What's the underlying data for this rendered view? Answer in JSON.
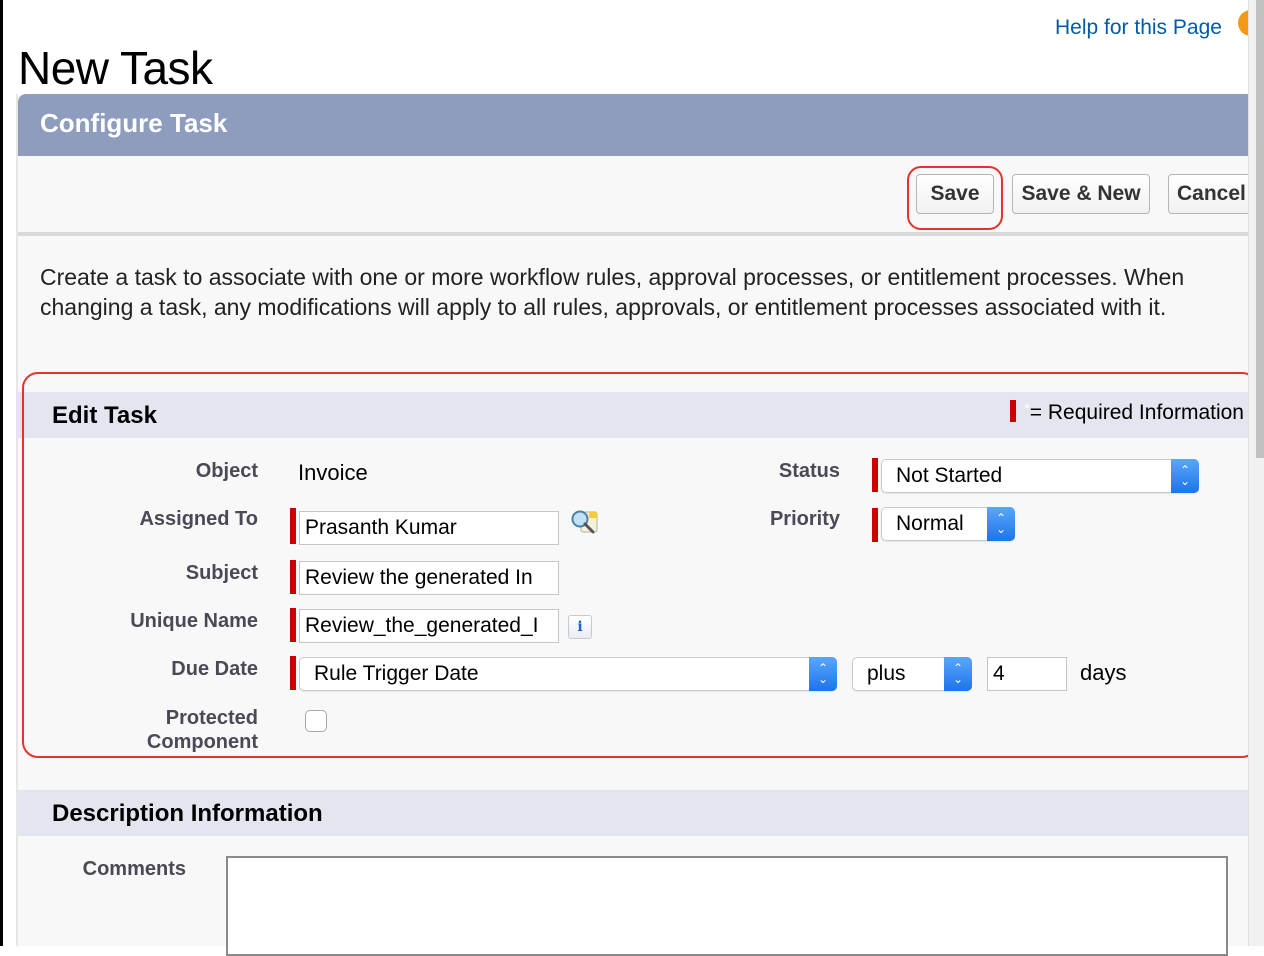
{
  "page": {
    "title": "New Task",
    "help_link": "Help for this Page"
  },
  "panel": {
    "title": "Configure Task",
    "buttons": {
      "save": "Save",
      "save_new": "Save & New",
      "cancel": "Cancel"
    },
    "intro": "Create a task to associate with one or more workflow rules, approval processes, or entitlement processes. When changing a task, any modifications will apply to all rules, approvals, or entitlement processes associated with it."
  },
  "edit_task": {
    "title": "Edit Task",
    "required_star": "*",
    "required_legend": "= Required Information",
    "fields": {
      "object": {
        "label": "Object",
        "value": "Invoice"
      },
      "assigned_to": {
        "label": "Assigned To",
        "value": "Prasanth Kumar"
      },
      "subject": {
        "label": "Subject",
        "value": "Review the generated In"
      },
      "unique_name": {
        "label": "Unique Name",
        "value": "Review_the_generated_I"
      },
      "due_date": {
        "label": "Due Date",
        "base": "Rule Trigger Date",
        "operator": "plus",
        "amount": "4",
        "unit": "days"
      },
      "protected": {
        "label_line1": "Protected",
        "label_line2": "Component",
        "checked": false
      },
      "status": {
        "label": "Status",
        "value": "Not Started"
      },
      "priority": {
        "label": "Priority",
        "value": "Normal"
      }
    }
  },
  "description": {
    "title": "Description Information",
    "comments_label": "Comments",
    "comments_value": ""
  },
  "colors": {
    "header_bg": "#8e9dbe",
    "section_bg": "#e3e6ef",
    "required": "#cc0000",
    "link": "#015ba7",
    "annotation": "#e8322c"
  }
}
